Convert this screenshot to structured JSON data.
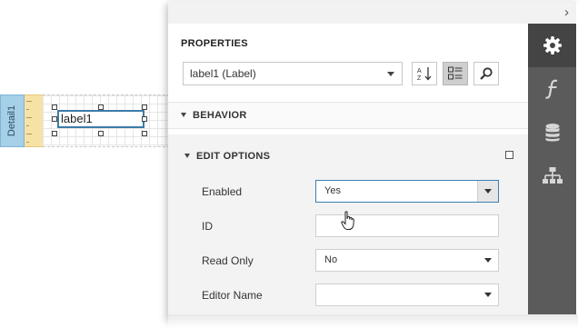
{
  "designer": {
    "band_name": "Detail1",
    "label_text": "label1"
  },
  "panel": {
    "collapse_icon": "chevron-right-icon",
    "section_title": "PROPERTIES",
    "selector_value": "label1 (Label)",
    "tools": [
      "sort-alphabetical-icon",
      "categorized-view-icon",
      "search-icon"
    ],
    "groups": {
      "behavior": "BEHAVIOR",
      "edit_options": "EDIT OPTIONS"
    },
    "properties": [
      {
        "label": "Enabled",
        "value": "Yes",
        "type": "dropdown"
      },
      {
        "label": "ID",
        "value": "",
        "type": "text"
      },
      {
        "label": "Read Only",
        "value": "No",
        "type": "dropdown"
      },
      {
        "label": "Editor Name",
        "value": "",
        "type": "dropdown"
      }
    ]
  },
  "tabs": [
    "gear-icon",
    "function-icon",
    "database-icon",
    "report-explorer-icon"
  ],
  "colors": {
    "tabbar": "#5b5b5b",
    "tab_active": "#444444",
    "focus_border": "#3c7fb1",
    "band_tab": "#a6cfe8"
  }
}
